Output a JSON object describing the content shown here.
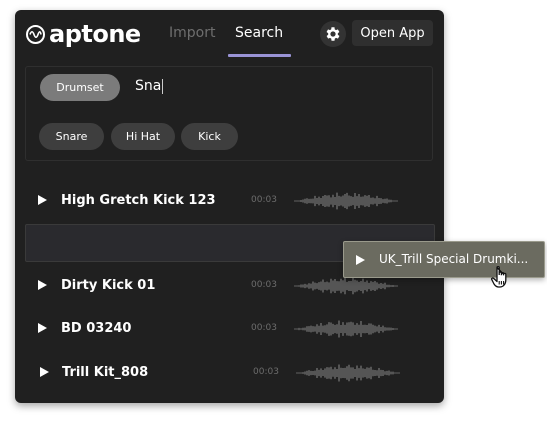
{
  "app": {
    "logo_text": "aptone"
  },
  "header": {
    "tabs": [
      {
        "label": "Import",
        "active": false
      },
      {
        "label": "Search",
        "active": true
      }
    ],
    "open_app_label": "Open App"
  },
  "search": {
    "active_filter": "Drumset",
    "query": "Sna",
    "suggestions": [
      "Snare",
      "Hi Hat",
      "Kick"
    ]
  },
  "results": [
    {
      "name": "High Gretch Kick 123",
      "duration": "00:03"
    },
    {
      "name": "Dirty Kick 01",
      "duration": "00:03"
    },
    {
      "name": "BD 03240",
      "duration": "00:03"
    },
    {
      "name": "Trill Kit_808",
      "duration": "00:03"
    }
  ],
  "dragging": {
    "name": "UK_Trill Special Drumki..."
  },
  "colors": {
    "background": "#202020",
    "accent": "#9a94d6",
    "drag_item": "#6b6b60"
  },
  "icons": [
    "logo-icon",
    "gear-icon",
    "play-icon",
    "waveform-icon",
    "hand-cursor-icon"
  ]
}
